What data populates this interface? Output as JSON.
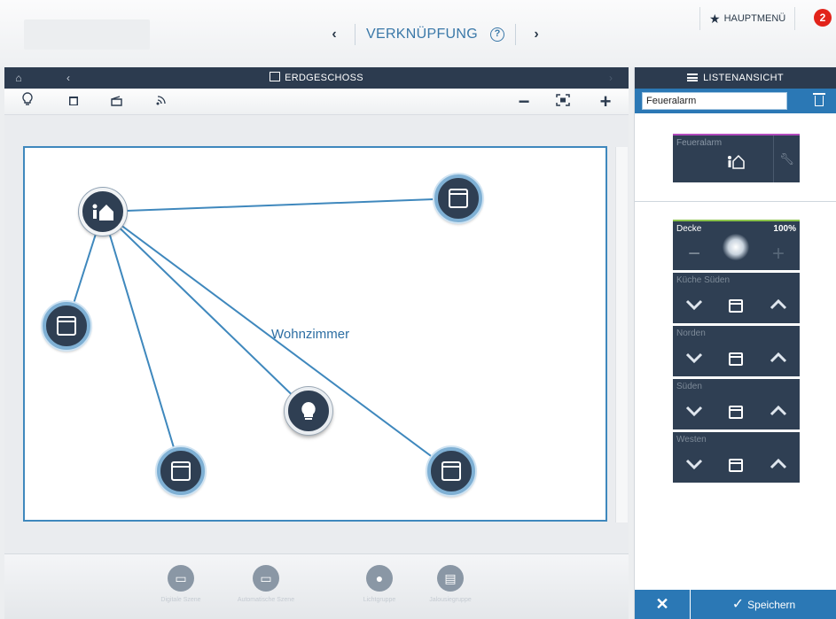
{
  "header": {
    "nav_title": "VERKNÜPFUNG",
    "help_glyph": "?",
    "prev_glyph": "‹",
    "next_glyph": "›",
    "main_menu_label": "HAUPTMENÜ",
    "notifications_count": "2"
  },
  "floor": {
    "title": "ERDGESCHOSS",
    "room_label": "Wohnzimmer"
  },
  "toolbar": {
    "zoom_out": "−",
    "zoom_in": "+"
  },
  "bottom_tray": {
    "items": [
      {
        "label": "Digitale Szene",
        "icon": "scene-icon"
      },
      {
        "label": "Automatische Szene",
        "icon": "scene-icon"
      },
      {
        "label": "Lichtgruppe",
        "icon": "light-group-icon"
      },
      {
        "label": "Jalousiegruppe",
        "icon": "blind-group-icon"
      }
    ]
  },
  "right_panel": {
    "header_label": "LISTENANSICHT",
    "search_value": "Feueralarm",
    "scene_card": {
      "name": "Feueralarm"
    },
    "devices": [
      {
        "name": "Decke",
        "type": "light",
        "value": "100%"
      },
      {
        "name": "Küche Süden",
        "type": "blind"
      },
      {
        "name": "Norden",
        "type": "blind"
      },
      {
        "name": "Süden",
        "type": "blind"
      },
      {
        "name": "Westen",
        "type": "blind"
      }
    ],
    "cancel_glyph": "✕",
    "save_label": "Speichern"
  },
  "colors": {
    "accent": "#2b78b5",
    "dark": "#2c3b4f",
    "link": "#3f88bd",
    "notification": "#e2231a"
  }
}
